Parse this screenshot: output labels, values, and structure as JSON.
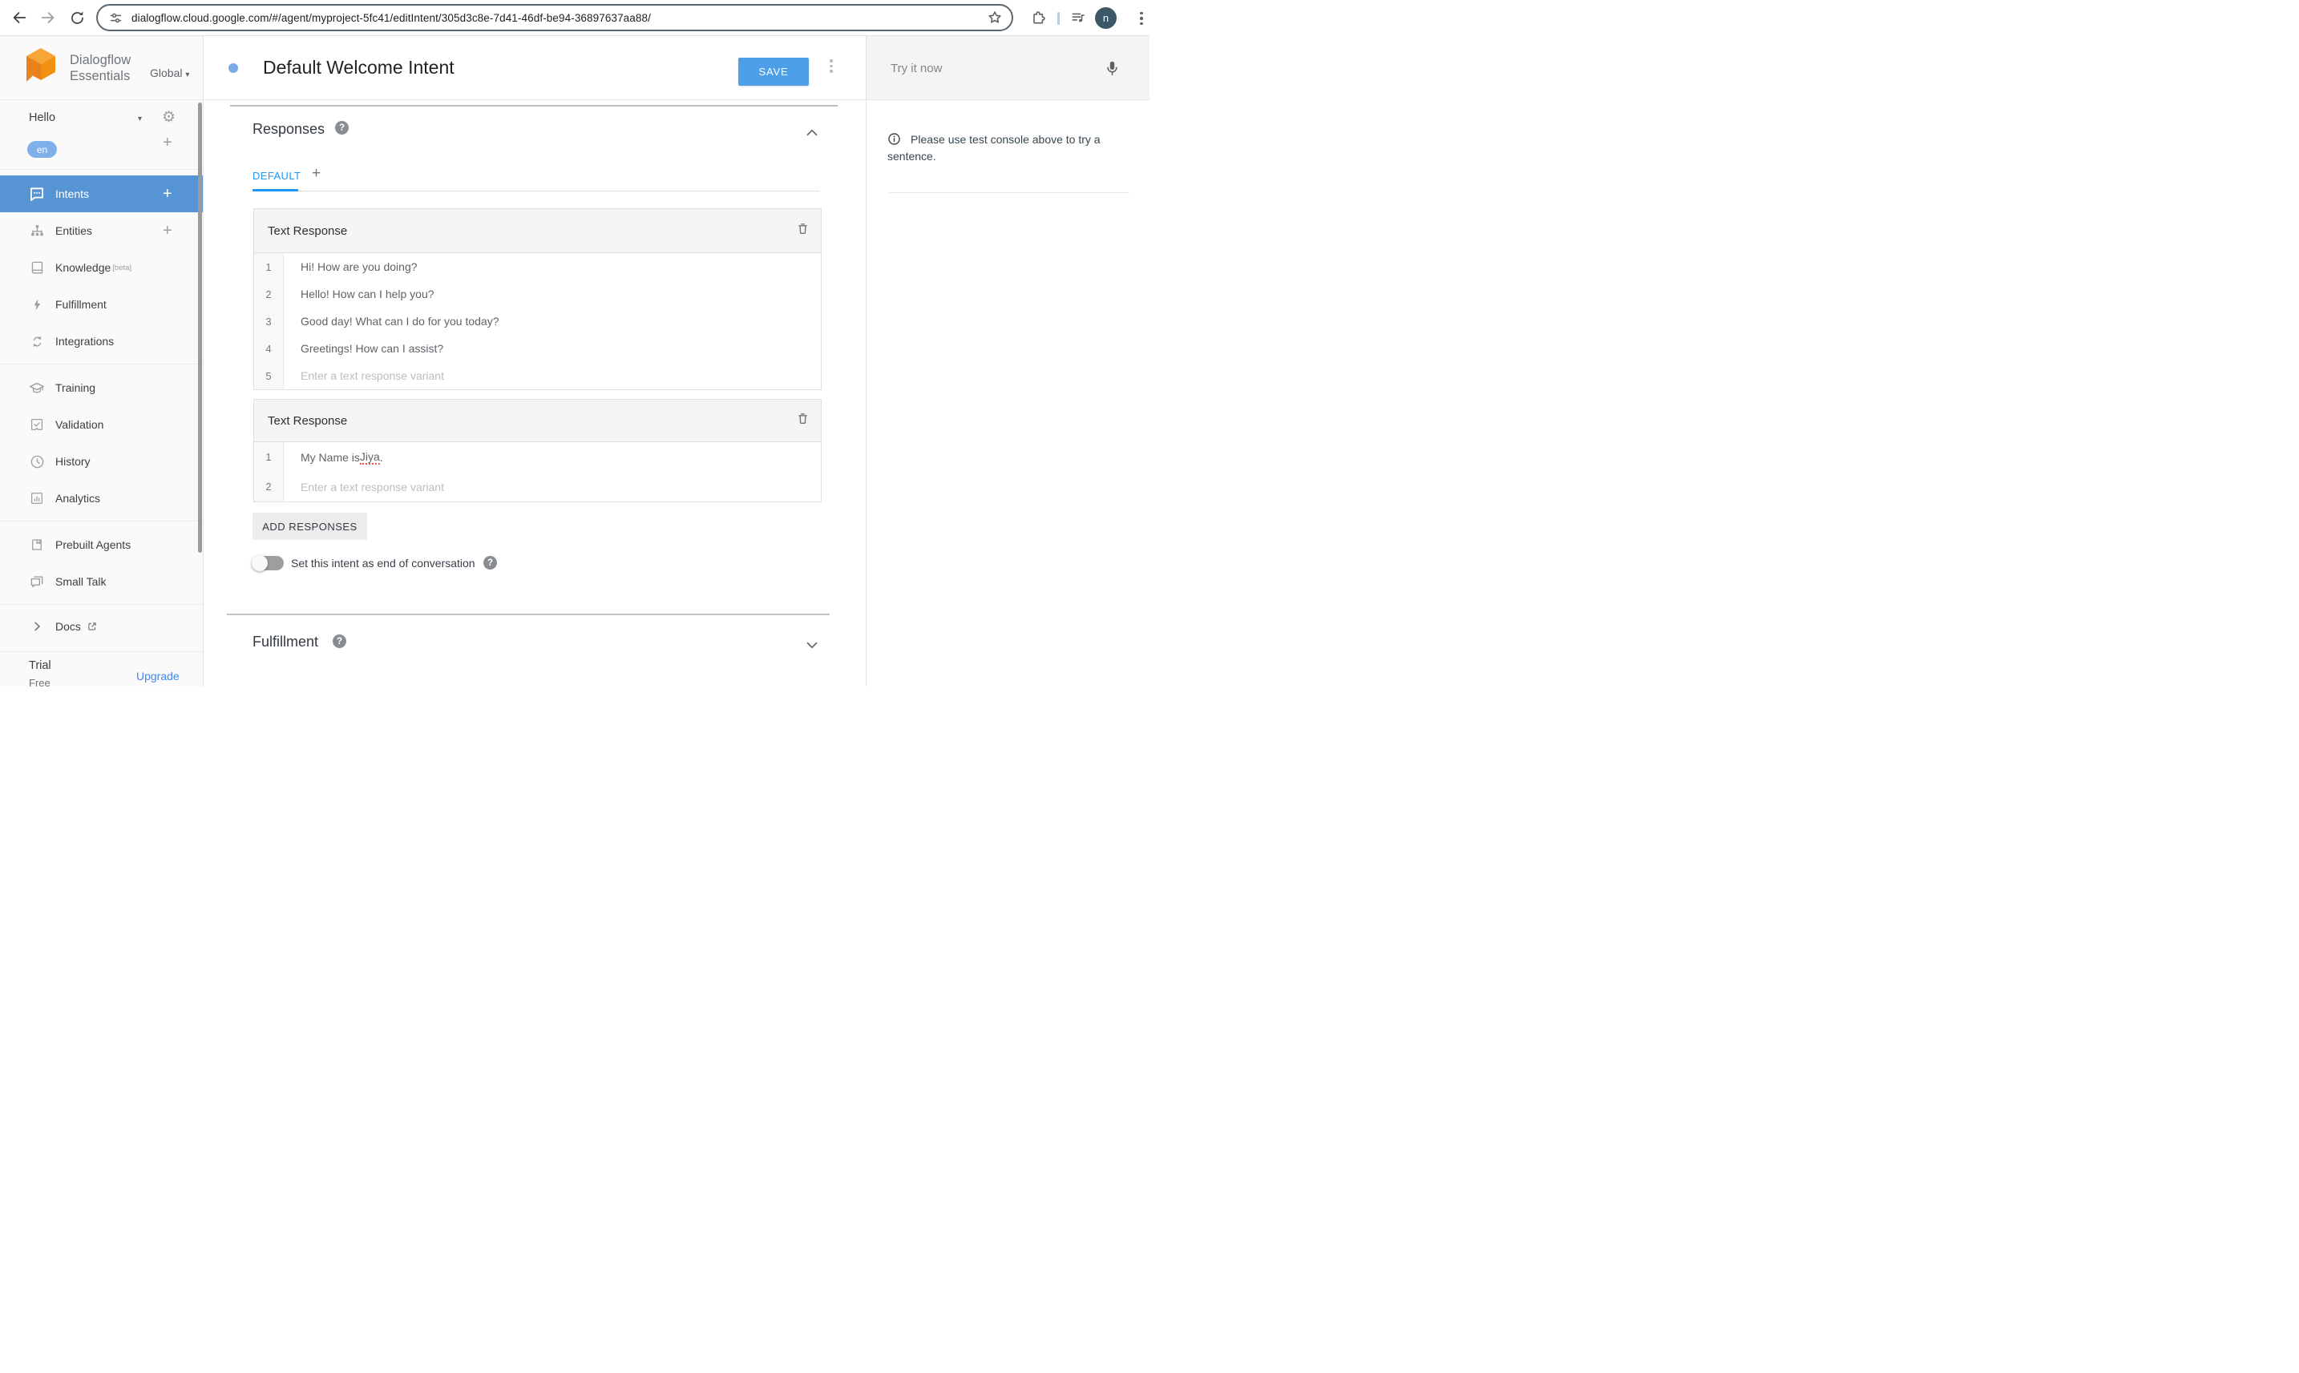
{
  "browser": {
    "url": "dialogflow.cloud.google.com/#/agent/myproject-5fc41/editIntent/305d3c8e-7d41-46df-be94-36897637aa88/",
    "avatar_letter": "n"
  },
  "brand": {
    "name_line1": "Dialogflow",
    "name_line2": "Essentials",
    "region": "Global"
  },
  "sidebar": {
    "agent_name": "Hello",
    "language": "en",
    "items": [
      {
        "label": "Intents"
      },
      {
        "label": "Entities"
      },
      {
        "label": "Knowledge",
        "badge": "[beta]"
      },
      {
        "label": "Fulfillment"
      },
      {
        "label": "Integrations"
      },
      {
        "label": "Training"
      },
      {
        "label": "Validation"
      },
      {
        "label": "History"
      },
      {
        "label": "Analytics"
      },
      {
        "label": "Prebuilt Agents"
      },
      {
        "label": "Small Talk"
      }
    ],
    "docs": "Docs",
    "plan": "Trial",
    "plan_tier": "Free",
    "upgrade": "Upgrade"
  },
  "header": {
    "title": "Default Welcome Intent",
    "save": "SAVE"
  },
  "try_panel": {
    "placeholder": "Try it now",
    "info": "Please use test console above to try a sentence."
  },
  "responses": {
    "title": "Responses",
    "tab": "DEFAULT",
    "cards": [
      {
        "title": "Text Response",
        "rows": [
          {
            "num": "1",
            "text": "Hi! How are you doing?"
          },
          {
            "num": "2",
            "text": "Hello! How can I help you?"
          },
          {
            "num": "3",
            "text": "Good day! What can I do for you today?"
          },
          {
            "num": "4",
            "text": "Greetings! How can I assist?"
          },
          {
            "num": "5",
            "placeholder": "Enter a text response variant"
          }
        ]
      },
      {
        "title": "Text Response",
        "rows": [
          {
            "num": "1",
            "text_before": "My Name is ",
            "misspelled": "Jiya",
            "text_after": "."
          },
          {
            "num": "2",
            "placeholder": "Enter a text response variant"
          }
        ]
      }
    ],
    "add_button": "ADD RESPONSES",
    "end_toggle_label": "Set this intent as end of conversation"
  },
  "fulfillment": {
    "title": "Fulfillment"
  },
  "colors": {
    "accent_blue": "#2196f3",
    "selected_nav_blue": "#5794d4",
    "save_button_blue": "#4da0e8",
    "language_pill_blue": "#7fb0ea",
    "upgrade_link_blue": "#4285f4",
    "logo_orange": "#f09018",
    "misspell_red": "#ef5350"
  }
}
